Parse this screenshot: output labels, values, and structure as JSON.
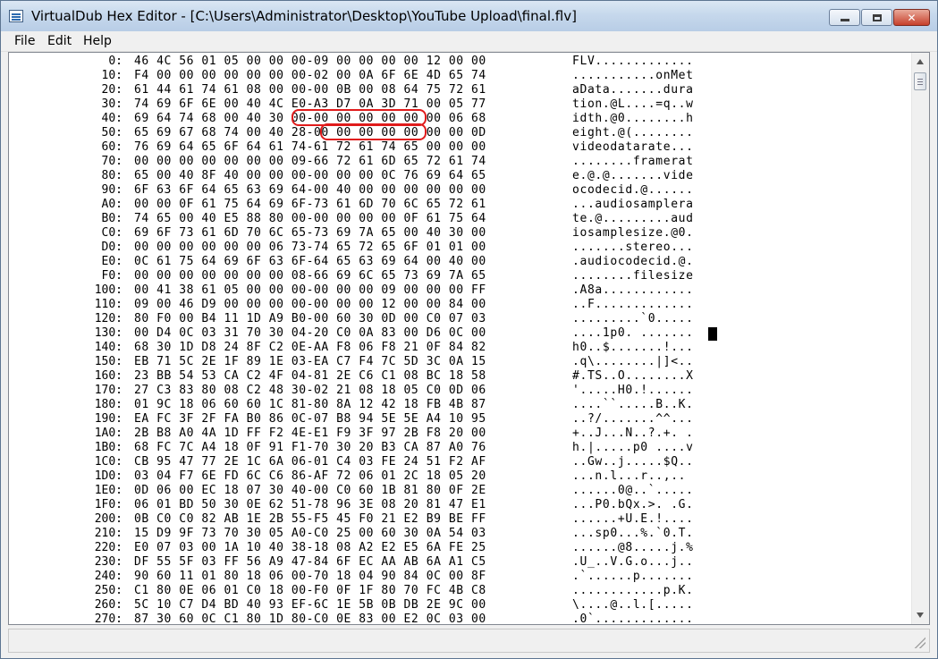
{
  "window": {
    "title": "VirtualDub Hex Editor - [C:\\Users\\Administrator\\Desktop\\YouTube Upload\\final.flv]"
  },
  "menu": {
    "items": [
      {
        "label": "File"
      },
      {
        "label": "Edit"
      },
      {
        "label": "Help"
      }
    ]
  },
  "hex": {
    "rows": [
      {
        "addr": "0:",
        "bytes": "46 4C 56 01 05 00 00 00-09 00 00 00 00 12 00 00",
        "ascii": "FLV............."
      },
      {
        "addr": "10:",
        "bytes": "F4 00 00 00 00 00 00 00-02 00 0A 6F 6E 4D 65 74",
        "ascii": "...........onMet"
      },
      {
        "addr": "20:",
        "bytes": "61 44 61 74 61 08 00 00-00 0B 00 08 64 75 72 61",
        "ascii": "aData.......dura"
      },
      {
        "addr": "30:",
        "bytes": "74 69 6F 6E 00 40 4C E0-A3 D7 0A 3D 71 00 05 77",
        "ascii": "tion.@L....=q..w"
      },
      {
        "addr": "40:",
        "bytes": "69 64 74 68 00 40 30 00-00 00 00 00 00 00 06 68",
        "ascii": "idth.@0........h"
      },
      {
        "addr": "50:",
        "bytes": "65 69 67 68 74 00 40 28-00 00 00 00 00 00 00 0D",
        "ascii": "eight.@(........"
      },
      {
        "addr": "60:",
        "bytes": "76 69 64 65 6F 64 61 74-61 72 61 74 65 00 00 00",
        "ascii": "videodatarate..."
      },
      {
        "addr": "70:",
        "bytes": "00 00 00 00 00 00 00 09-66 72 61 6D 65 72 61 74",
        "ascii": "........framerat"
      },
      {
        "addr": "80:",
        "bytes": "65 00 40 8F 40 00 00 00-00 00 00 0C 76 69 64 65",
        "ascii": "e.@.@.......vide"
      },
      {
        "addr": "90:",
        "bytes": "6F 63 6F 64 65 63 69 64-00 40 00 00 00 00 00 00",
        "ascii": "ocodecid.@......"
      },
      {
        "addr": "A0:",
        "bytes": "00 00 0F 61 75 64 69 6F-73 61 6D 70 6C 65 72 61",
        "ascii": "...audiosamplera"
      },
      {
        "addr": "B0:",
        "bytes": "74 65 00 40 E5 88 80 00-00 00 00 00 0F 61 75 64",
        "ascii": "te.@.........aud"
      },
      {
        "addr": "C0:",
        "bytes": "69 6F 73 61 6D 70 6C 65-73 69 7A 65 00 40 30 00",
        "ascii": "iosamplesize.@0."
      },
      {
        "addr": "D0:",
        "bytes": "00 00 00 00 00 00 06 73-74 65 72 65 6F 01 01 00",
        "ascii": ".......stereo..."
      },
      {
        "addr": "E0:",
        "bytes": "0C 61 75 64 69 6F 63 6F-64 65 63 69 64 00 40 00",
        "ascii": ".audiocodecid.@."
      },
      {
        "addr": "F0:",
        "bytes": "00 00 00 00 00 00 00 08-66 69 6C 65 73 69 7A 65",
        "ascii": "........filesize"
      },
      {
        "addr": "100:",
        "bytes": "00 41 38 61 05 00 00 00-00 00 00 09 00 00 00 FF",
        "ascii": ".A8a............"
      },
      {
        "addr": "110:",
        "bytes": "09 00 46 D9 00 00 00 00-00 00 00 12 00 00 84 00",
        "ascii": "..F............."
      },
      {
        "addr": "120:",
        "bytes": "80 F0 00 B4 11 1D A9 B0-00 60 30 0D 00 C0 07 03",
        "ascii": ".........`0....."
      },
      {
        "addr": "130:",
        "bytes": "00 D4 0C 03 31 70 30 04-20 C0 0A 83 00 D6 0C 00",
        "ascii": "....1p0. ......."
      },
      {
        "addr": "140:",
        "bytes": "68 30 1D D8 24 8F C2 0E-AA F8 06 F8 21 0F 84 82",
        "ascii": "h0..$.......!..."
      },
      {
        "addr": "150:",
        "bytes": "EB 71 5C 2E 1F 89 1E 03-EA C7 F4 7C 5D 3C 0A 15",
        "ascii": ".q\\........|]<.."
      },
      {
        "addr": "160:",
        "bytes": "23 BB 54 53 CA C2 4F 04-81 2E C6 C1 08 BC 18 58",
        "ascii": "#.TS..O........X"
      },
      {
        "addr": "170:",
        "bytes": "27 C3 83 80 08 C2 48 30-02 21 08 18 05 C0 0D 06",
        "ascii": "'.....H0.!......"
      },
      {
        "addr": "180:",
        "bytes": "01 9C 18 06 60 60 1C 81-80 8A 12 42 18 FB 4B 87",
        "ascii": "....``.....B..K."
      },
      {
        "addr": "190:",
        "bytes": "EA FC 3F 2F FA B0 86 0C-07 B8 94 5E 5E A4 10 95",
        "ascii": "..?/.......^^..."
      },
      {
        "addr": "1A0:",
        "bytes": "2B B8 A0 4A 1D FF F2 4E-E1 F9 3F 97 2B F8 20 00",
        "ascii": "+..J...N..?.+. ."
      },
      {
        "addr": "1B0:",
        "bytes": "68 FC 7C A4 18 0F 91 F1-70 30 20 B3 CA 87 A0 76",
        "ascii": "h.|.....p0 ....v"
      },
      {
        "addr": "1C0:",
        "bytes": "CB 95 47 77 2E 1C 6A 06-01 C4 03 FE 24 51 F2 AF",
        "ascii": "..Gw..j.....$Q.."
      },
      {
        "addr": "1D0:",
        "bytes": "03 04 F7 6E FD 6C C6 86-AF 72 06 01 2C 18 05 20",
        "ascii": "...n.l...r..,.. "
      },
      {
        "addr": "1E0:",
        "bytes": "0D 06 00 EC 18 07 30 40-00 C0 60 1B 81 80 0F 2E",
        "ascii": "......0@..`....."
      },
      {
        "addr": "1F0:",
        "bytes": "06 01 BD 50 30 0E 62 51-78 96 3E 08 20 81 47 E1",
        "ascii": "...P0.bQx.>. .G."
      },
      {
        "addr": "200:",
        "bytes": "0B C0 C0 82 AB 1E 2B 55-F5 45 F0 21 E2 B9 BE FF",
        "ascii": "......+U.E.!...."
      },
      {
        "addr": "210:",
        "bytes": "15 D9 9F 73 70 30 05 A0-C0 25 00 60 30 0A 54 03",
        "ascii": "...sp0...%.`0.T."
      },
      {
        "addr": "220:",
        "bytes": "E0 07 03 00 1A 10 40 38-18 08 A2 E2 E5 6A FE 25",
        "ascii": "......@8.....j.%"
      },
      {
        "addr": "230:",
        "bytes": "DF 55 5F 03 FF 56 A9 47-84 6F EC AA AB 6A A1 C5",
        "ascii": ".U_..V.G.o...j.."
      },
      {
        "addr": "240:",
        "bytes": "90 60 11 01 80 18 06 00-70 18 04 90 84 0C 00 8F",
        "ascii": ".`......p......."
      },
      {
        "addr": "250:",
        "bytes": "C1 80 0E 06 01 C0 18 00-F0 0F 1F 80 70 FC 4B C8",
        "ascii": "............p.K."
      },
      {
        "addr": "260:",
        "bytes": "5C 10 C7 D4 BD 40 93 EF-6C 1E 5B 0B DB 2E 9C 00",
        "ascii": "\\....@..l.[....."
      },
      {
        "addr": "270:",
        "bytes": "87 30 60 0C C1 80 1D 80-C0 0E 83 00 E2 0C 03 00",
        "ascii": ".0`............."
      }
    ]
  },
  "status": {
    "text": ""
  }
}
